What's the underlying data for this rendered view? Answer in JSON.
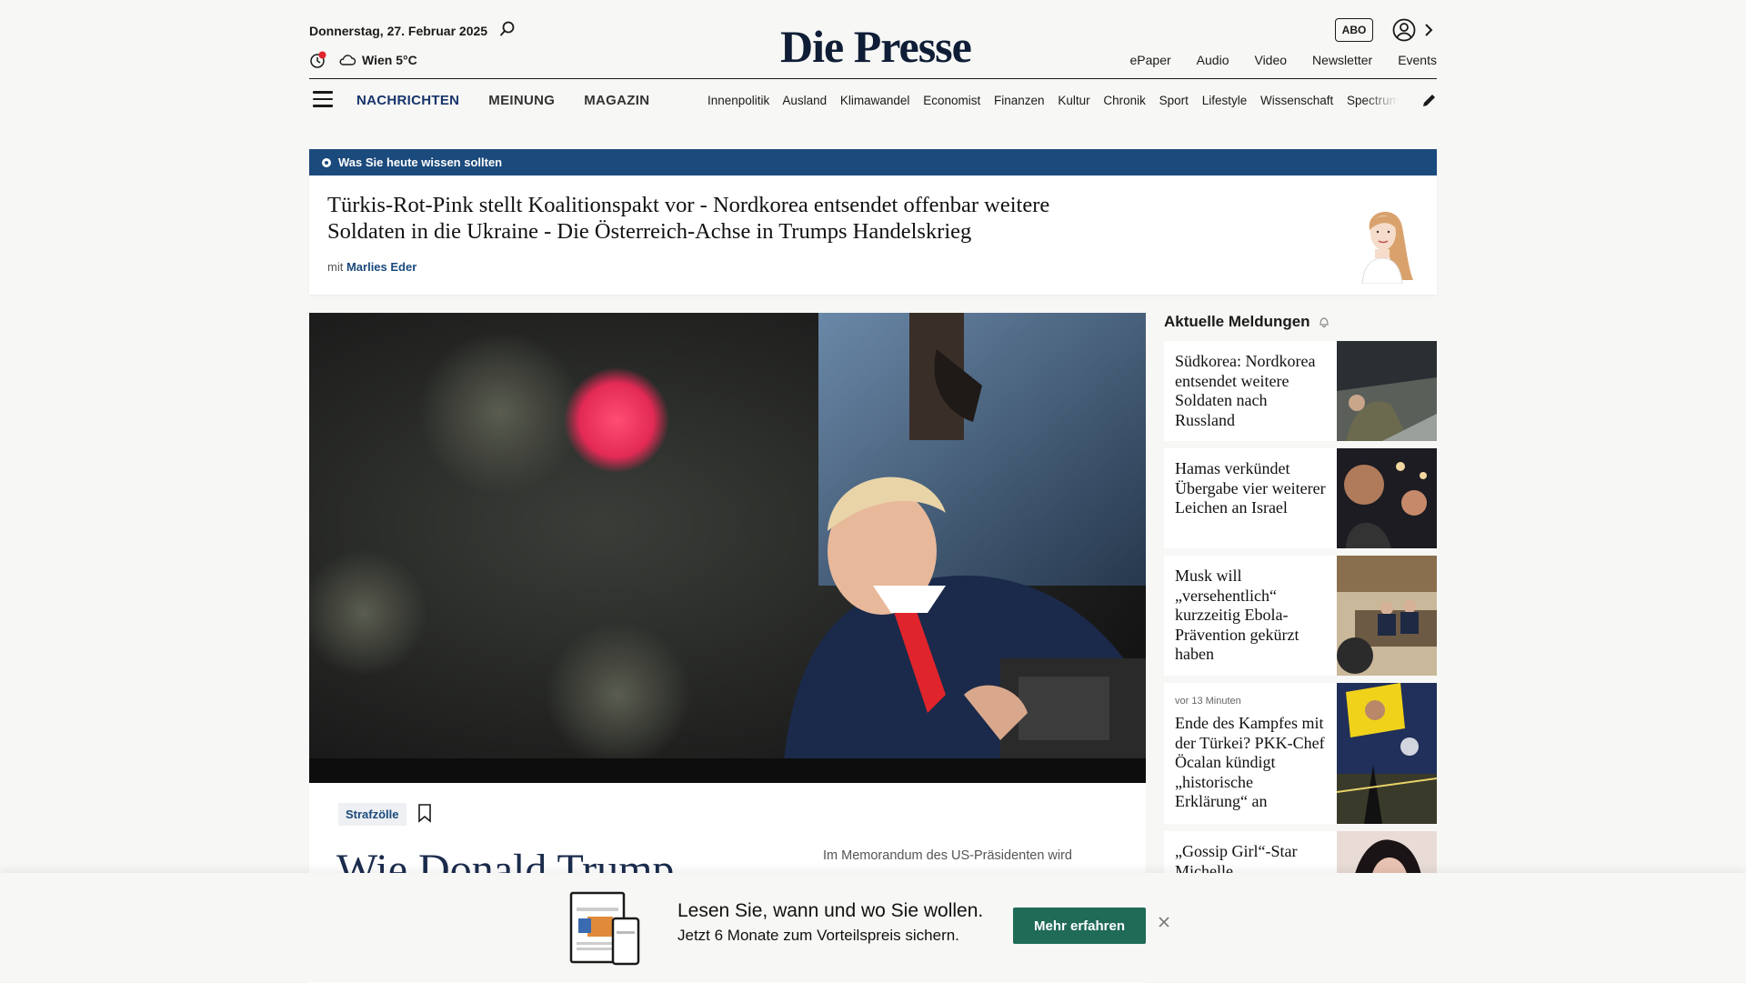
{
  "header": {
    "date": "Donnerstag, 27. Februar 2025",
    "weather": "Wien 5°C",
    "logo": "Die Presse",
    "abo_label": "ABO",
    "top_links": [
      "ePaper",
      "Audio",
      "Video",
      "Newsletter",
      "Events"
    ]
  },
  "nav": {
    "main": [
      "NACHRICHTEN",
      "MEINUNG",
      "MAGAZIN"
    ],
    "sub": [
      "Innenpolitik",
      "Ausland",
      "Klimawandel",
      "Economist",
      "Finanzen",
      "Kultur",
      "Chronik",
      "Sport",
      "Lifestyle",
      "Wissenschaft",
      "Spectrum"
    ]
  },
  "briefing": {
    "bar_label": "Was Sie heute wissen sollten",
    "headline": "Türkis-Rot-Pink stellt Koalitionspakt vor - Nordkorea entsendet offenbar weitere Soldaten in die Ukraine - Die Österreich-Achse in Trumps Handelskrieg",
    "author_prefix": "mit",
    "author": "Marlies Eder"
  },
  "lead": {
    "tag": "Strafzölle",
    "title": "Wie Donald Trump",
    "teaser": "Im Memorandum des US-Präsidenten wird"
  },
  "sidebar": {
    "heading": "Aktuelle Meldungen",
    "items": [
      {
        "title": "Südkorea: Nordkorea entsendet weitere Soldaten nach Russland",
        "time": ""
      },
      {
        "title": "Hamas verkündet Übergabe vier weiterer Leichen an Israel",
        "time": ""
      },
      {
        "title": "Musk will „versehentlich“ kurzzeitig Ebola-Prävention gekürzt haben",
        "time": ""
      },
      {
        "title": "Ende des Kampfes mit der Türkei? PKK-Chef Öcalan kündigt „historische Erklärung“ an",
        "time": "vor 13 Minuten"
      },
      {
        "title": "„Gossip Girl“-Star Michelle",
        "time": ""
      }
    ]
  },
  "promo": {
    "line1": "Lesen Sie, wann und wo Sie wollen.",
    "line2": "Jetzt 6 Monate zum Vorteilspreis sichern.",
    "button": "Mehr erfahren"
  },
  "colors": {
    "brand_navy": "#1b4a7c",
    "cta_green": "#1f6b58",
    "alert_red": "#e0242c"
  }
}
